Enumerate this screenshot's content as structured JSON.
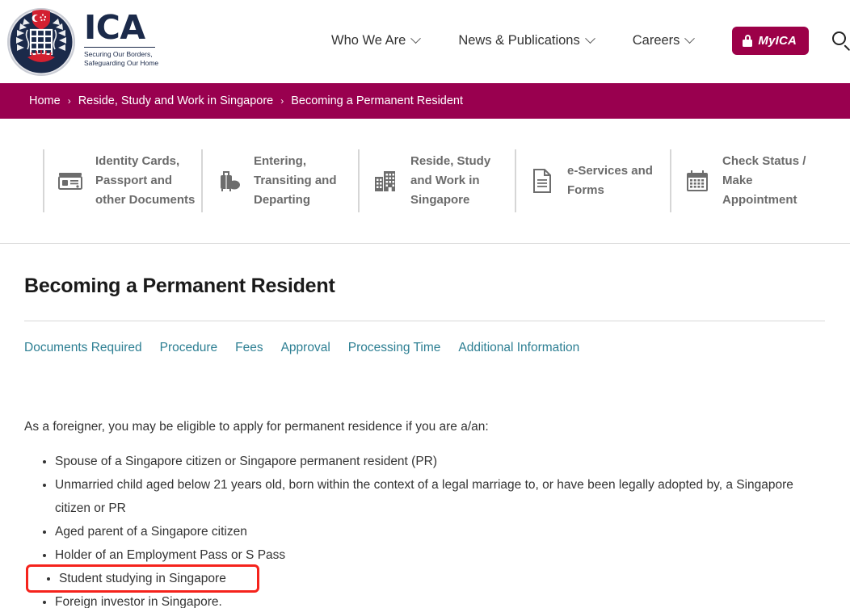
{
  "header": {
    "logo": {
      "crest_icon": "ica-crest-icon",
      "wordmark": "ICA",
      "tagline_line1": "Securing Our Borders,",
      "tagline_line2": "Safeguarding Our Home"
    },
    "nav": [
      {
        "label": "Who We Are",
        "has_dropdown": true
      },
      {
        "label": "News & Publications",
        "has_dropdown": true
      },
      {
        "label": "Careers",
        "has_dropdown": true
      }
    ],
    "myica": {
      "label": "MyICA",
      "icon": "lock-icon"
    },
    "search": {
      "icon": "search-icon"
    }
  },
  "breadcrumb": {
    "separator": "›",
    "items": [
      "Home",
      "Reside, Study and Work in Singapore",
      "Becoming a Permanent Resident"
    ]
  },
  "quicklinks": [
    {
      "label": "Identity Cards, Passport and other Documents",
      "icon": "id-card-icon"
    },
    {
      "label": "Entering, Transiting and Departing",
      "icon": "luggage-icon"
    },
    {
      "label": "Reside, Study and Work in Singapore",
      "icon": "building-icon"
    },
    {
      "label": "e-Services and Forms",
      "icon": "document-icon"
    },
    {
      "label": "Check Status / Make Appointment",
      "icon": "calendar-icon"
    }
  ],
  "main": {
    "page_title": "Becoming a Permanent Resident",
    "tabs": [
      "Documents Required",
      "Procedure",
      "Fees",
      "Approval",
      "Processing Time",
      "Additional Information"
    ],
    "intro": "As a foreigner, you may be eligible to apply for permanent residence if you are a/an:",
    "eligibility": [
      "Spouse of a Singapore citizen or Singapore permanent resident (PR)",
      "Unmarried child aged below 21 years old, born within the context of a legal marriage to, or have been legally adopted by, a Singapore citizen or PR",
      "Aged parent of a Singapore citizen",
      "Holder of an Employment Pass or S Pass",
      "Student studying in Singapore",
      "Foreign investor in Singapore."
    ],
    "highlight_index": 4
  },
  "colors": {
    "brand_magenta": "#99004f",
    "myica_magenta": "#9c0048",
    "link_teal": "#2d7f93",
    "logo_navy": "#1b2a4a",
    "annotation_red": "#f5231c",
    "icon_grey": "#6d6d6d"
  }
}
